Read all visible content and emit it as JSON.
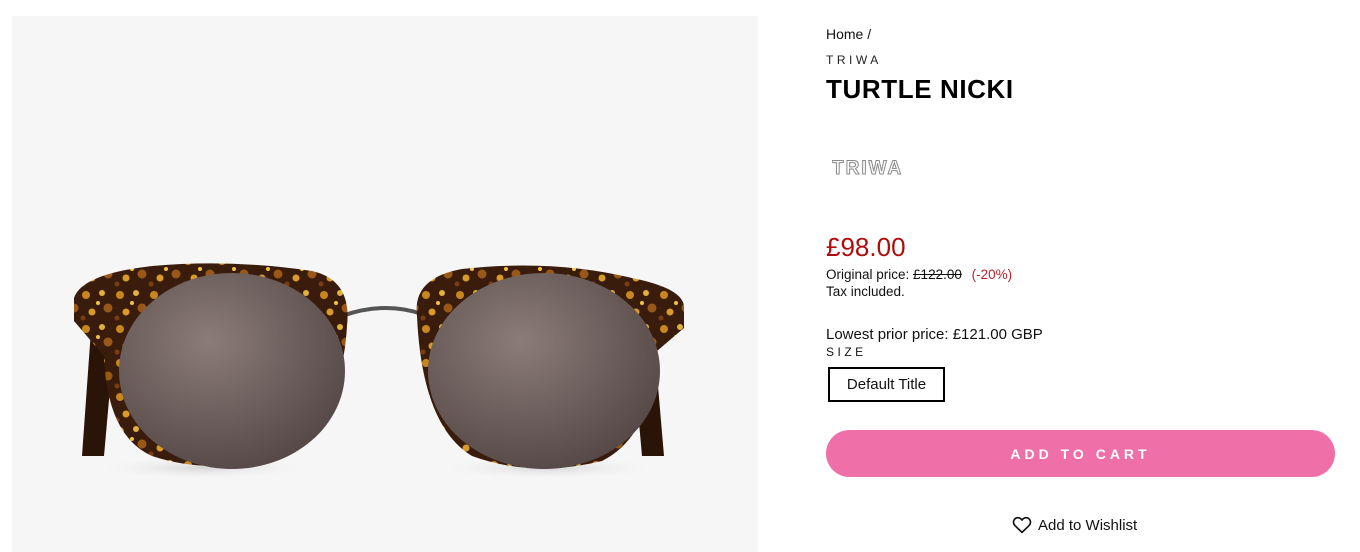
{
  "product": {
    "image_alt": "Turtle Nicki sunglasses",
    "breadcrumb": {
      "home": "Home",
      "separator": "/"
    },
    "vendor": "TRIWA",
    "title": "TURTLE NICKI",
    "brand_logo_text": "TRIWA",
    "price": "£98.00",
    "original_price_label": "Original price:",
    "original_price": "£122.00",
    "discount": "(-20%)",
    "tax_note": "Tax included.",
    "lowest_prior_price": "Lowest prior price: £121.00 GBP",
    "size_label": "SIZE",
    "size_option": "Default Title",
    "add_to_cart_label": "ADD TO CART",
    "wishlist_label": "Add to Wishlist"
  },
  "colors": {
    "sale_price": "#b00c0c",
    "add_to_cart_bg": "#ef6fa8",
    "gallery_bg": "#f6f6f6"
  },
  "icons": [
    "heart-icon"
  ]
}
